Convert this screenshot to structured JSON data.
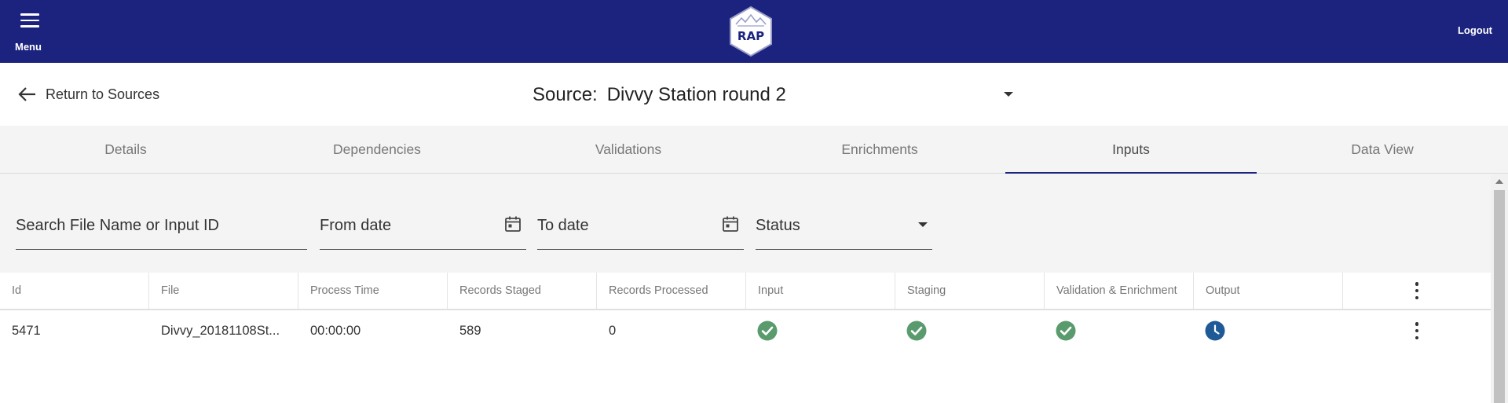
{
  "topbar": {
    "menu_label": "Menu",
    "logo_text": "RAP",
    "logout_label": "Logout",
    "bg_color": "#1b237e"
  },
  "header": {
    "return_label": "Return to Sources",
    "source_label": "Source:",
    "source_value": "Divvy Station round 2"
  },
  "tabs": [
    {
      "label": "Details",
      "active": false
    },
    {
      "label": "Dependencies",
      "active": false
    },
    {
      "label": "Validations",
      "active": false
    },
    {
      "label": "Enrichments",
      "active": false
    },
    {
      "label": "Inputs",
      "active": true
    },
    {
      "label": "Data View",
      "active": false
    }
  ],
  "filters": {
    "search_placeholder": "Search File Name or Input ID",
    "from_placeholder": "From date",
    "to_placeholder": "To date",
    "status_placeholder": "Status"
  },
  "table": {
    "columns": [
      "Id",
      "File",
      "Process Time",
      "Records Staged",
      "Records Processed",
      "Input",
      "Staging",
      "Validation & Enrichment",
      "Output"
    ],
    "rows": [
      {
        "id": "5471",
        "file": "Divvy_20181108St...",
        "process_time": "00:00:00",
        "records_staged": "589",
        "records_processed": "0",
        "input_status": "check-circle-icon",
        "staging_status": "check-circle-icon",
        "validation_status": "check-circle-icon",
        "output_status": "clock-icon"
      }
    ]
  },
  "colors": {
    "accent": "#1b237e",
    "success": "#5a9b6e",
    "pending": "#1f5a96"
  }
}
